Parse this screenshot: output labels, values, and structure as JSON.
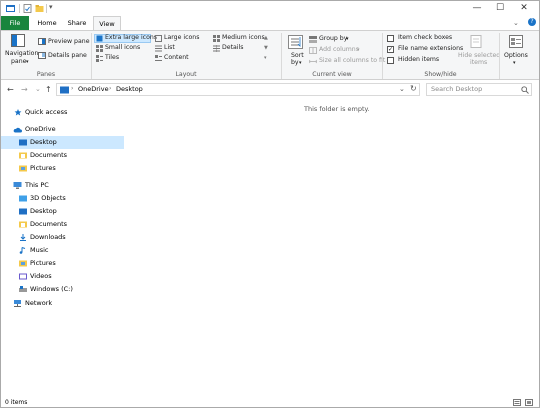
{
  "titlebar": {
    "qat_undo_glyph": "↩",
    "window_controls": {
      "minimize": "—",
      "maximize": "☐",
      "close": "✕"
    }
  },
  "tabs": {
    "file": "File",
    "home": "Home",
    "share": "Share",
    "view": "View"
  },
  "ribbon": {
    "panes": {
      "navigation_pane": "Navigation",
      "navigation_pane_2": "pane",
      "preview_pane": "Preview pane",
      "details_pane": "Details pane",
      "group_label": "Panes"
    },
    "layout": {
      "extra_large_icons": "Extra large icons",
      "large_icons": "Large icons",
      "medium_icons": "Medium icons",
      "small_icons": "Small icons",
      "list": "List",
      "details": "Details",
      "tiles": "Tiles",
      "content": "Content",
      "group_label": "Layout"
    },
    "current_view": {
      "sort_by": "Sort",
      "sort_by_2": "by",
      "group_by": "Group by",
      "add_columns": "Add columns",
      "size_all_columns": "Size all columns to fit",
      "group_label": "Current view"
    },
    "show_hide": {
      "item_check_boxes": "Item check boxes",
      "file_name_extensions": "File name extensions",
      "hidden_items": "Hidden items",
      "hide_selected": "Hide selected",
      "hide_selected_2": "items",
      "group_label": "Show/hide",
      "checks": {
        "item_check_boxes": false,
        "file_name_extensions": true,
        "hidden_items": false
      }
    },
    "options": "Options"
  },
  "navbar": {
    "back": "←",
    "forward": "→",
    "recent": "⌄",
    "up": "↑",
    "path": [
      "OneDrive",
      "Desktop"
    ],
    "separator": "›",
    "search_placeholder": "Search Desktop"
  },
  "navpane": {
    "quick_access": "Quick access",
    "onedrive": "OneDrive",
    "onedrive_items": [
      "Desktop",
      "Documents",
      "Pictures"
    ],
    "this_pc": "This PC",
    "this_pc_items": [
      "3D Objects",
      "Desktop",
      "Documents",
      "Downloads",
      "Music",
      "Pictures",
      "Videos",
      "Windows (C:)"
    ],
    "network": "Network"
  },
  "content": {
    "empty_message": "This folder is empty."
  },
  "status": {
    "items": "0 items"
  },
  "colors": {
    "file_tab": "#19853d",
    "selected": "#cce8ff",
    "accent": "#1a73c7"
  }
}
